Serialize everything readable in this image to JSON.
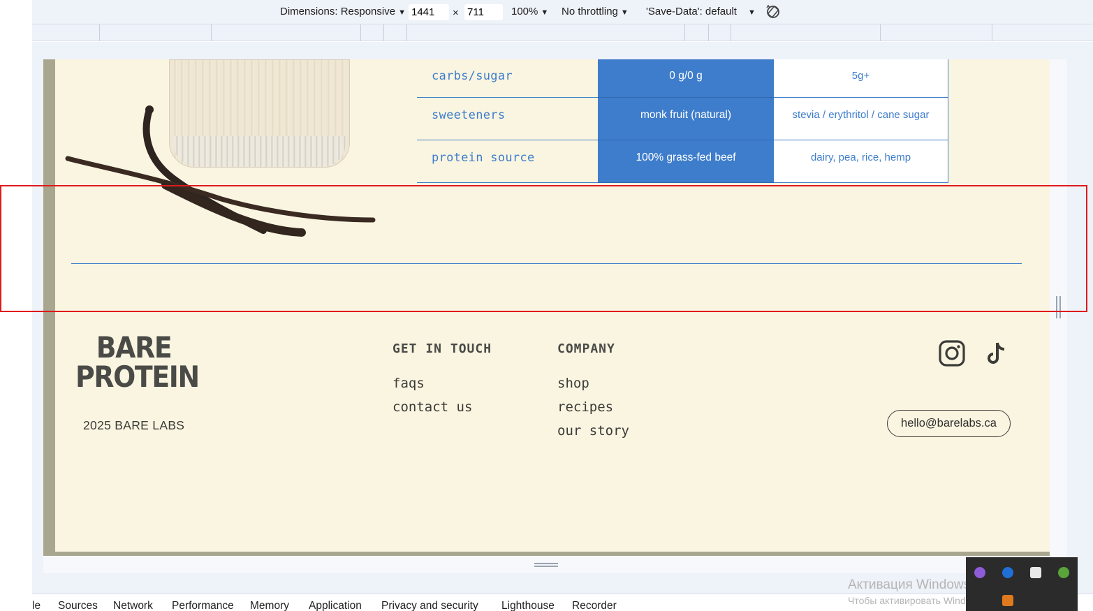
{
  "devtools": {
    "dimensions_label": "Dimensions: Responsive",
    "width_value": "1441",
    "times": "×",
    "height_value": "711",
    "zoom": "100%",
    "throttling": "No throttling",
    "save_data": "'Save-Data': default",
    "tabs": [
      "le",
      "Sources",
      "Network",
      "Performance",
      "Memory",
      "Application",
      "Privacy and security",
      "Lighthouse",
      "Recorder"
    ]
  },
  "comparison": {
    "rows": [
      {
        "label": "carbs/sugar",
        "bare": "0 g/0 g",
        "other": "5g+"
      },
      {
        "label": "sweeteners",
        "bare": "monk fruit (natural)",
        "other": "stevia / erythritol / cane sugar"
      },
      {
        "label": "protein source",
        "bare": "100% grass-fed beef",
        "other": "dairy, pea, rice, hemp"
      }
    ]
  },
  "footer": {
    "logo_line1": "BARE",
    "logo_line2": "PROTEIN",
    "copyright": "2025 BARE LABS",
    "get_in_touch_title": "GET IN TOUCH",
    "get_in_touch_links": [
      "faqs",
      "contact us"
    ],
    "company_title": "COMPANY",
    "company_links": [
      "shop",
      "recipes",
      "our story"
    ],
    "email": "hello@barelabs.ca",
    "social_icons": [
      "instagram-icon",
      "tiktok-icon"
    ]
  },
  "watermark": {
    "line1": "Активация Windows",
    "line2": "Чтобы активировать Windows, перейдите в разде"
  },
  "colors": {
    "accent_blue": "#3e7dcb",
    "page_bg": "#faf5e1",
    "highlight_red": "#e0191c"
  }
}
